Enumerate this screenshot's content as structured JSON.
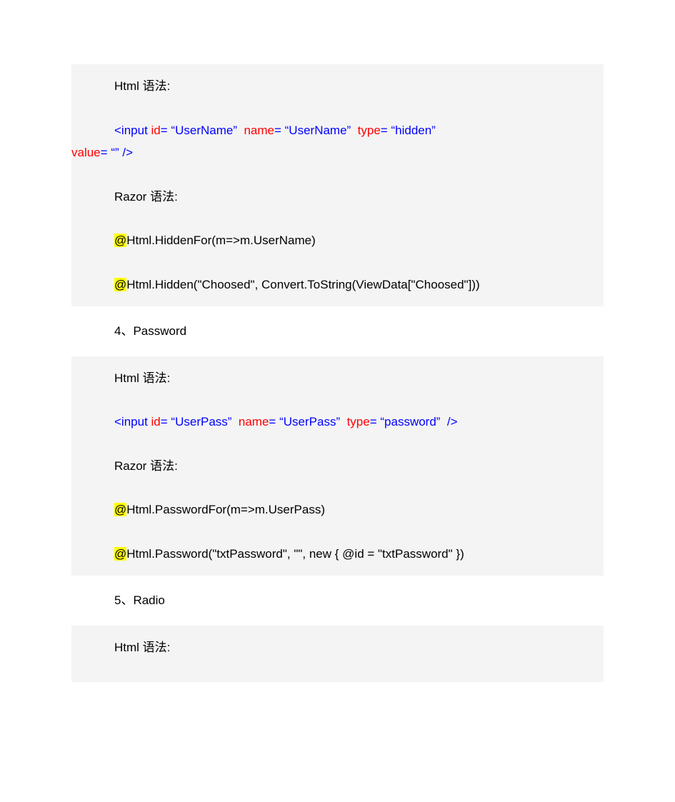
{
  "block1": {
    "htmlSyntax": "Html 语法:",
    "input": {
      "open": "<input ",
      "id": "id",
      "eq1": "=",
      "val1": "“UserName”",
      "name": "name",
      "eq2": "=",
      "val2": "“UserName”",
      "type": "type",
      "eq3": "=",
      "val3": "“hidden”",
      "value": "value",
      "eq4": "=",
      "val4": "“”",
      "close": "/>"
    },
    "razorSyntax": "Razor 语法:",
    "at1": "@",
    "razor1": "Html.HiddenFor(m=>m.UserName)",
    "at2": "@",
    "razor2": "Html.Hidden(\"Choosed\", Convert.ToString(ViewData[\"Choosed\"]))"
  },
  "section4": "4、Password",
  "block2": {
    "htmlSyntax": "Html 语法:",
    "input": {
      "open": "<input ",
      "id": "id",
      "eq1": "=",
      "val1": "“UserPass”",
      "name": "name",
      "eq2": "=",
      "val2": "“UserPass”",
      "type": "type",
      "eq3": "=",
      "val3": "“password”",
      "close": "/>"
    },
    "razorSyntax": "Razor 语法:",
    "at1": "@",
    "razor1": "Html.PasswordFor(m=>m.UserPass)",
    "at2": "@",
    "razor2": "Html.Password(\"txtPassword\", \"\", new { @id = \"txtPassword\" })"
  },
  "section5": "5、Radio",
  "block3": {
    "htmlSyntax": "Html 语法:"
  }
}
